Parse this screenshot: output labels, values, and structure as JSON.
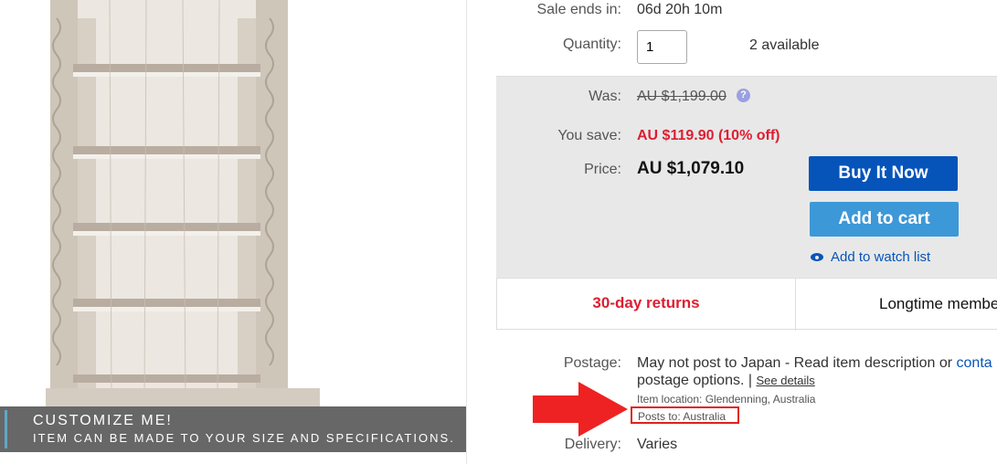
{
  "image": {
    "banner_title": "CUSTOMIZE ME!",
    "banner_subtitle": "ITEM CAN BE MADE TO YOUR SIZE AND SPECIFICATIONS."
  },
  "sale": {
    "label": "Sale ends in:",
    "value": "06d 20h 10m"
  },
  "quantity": {
    "label": "Quantity:",
    "value": "1",
    "available": "2 available"
  },
  "pricing": {
    "was_label": "Was:",
    "was_value": "AU $1,199.00",
    "help_icon": "?",
    "save_label": "You save:",
    "save_value": "AU $119.90 (10% off)",
    "price_label": "Price:",
    "price_value": "AU $1,079.10"
  },
  "actions": {
    "buy_now": "Buy It Now",
    "add_to_cart": "Add to cart",
    "watch_list": "Add to watch list"
  },
  "badges": {
    "returns": "30-day returns",
    "member": "Longtime membe"
  },
  "postage": {
    "label": "Postage:",
    "line1_text": "May not post to Japan - Read item description or ",
    "line1_link": "conta",
    "line2_text": "postage options. | ",
    "see_details": "See details",
    "location": "Item location:  Glendenning, Australia",
    "posts_to": "Posts to:  Australia"
  },
  "delivery": {
    "label": "Delivery:",
    "value": "Varies"
  },
  "colors": {
    "accent_blue": "#0654ba",
    "cart_blue": "#3d98d8",
    "save_red": "#dd1e31",
    "arrow_red": "#ee2222"
  }
}
